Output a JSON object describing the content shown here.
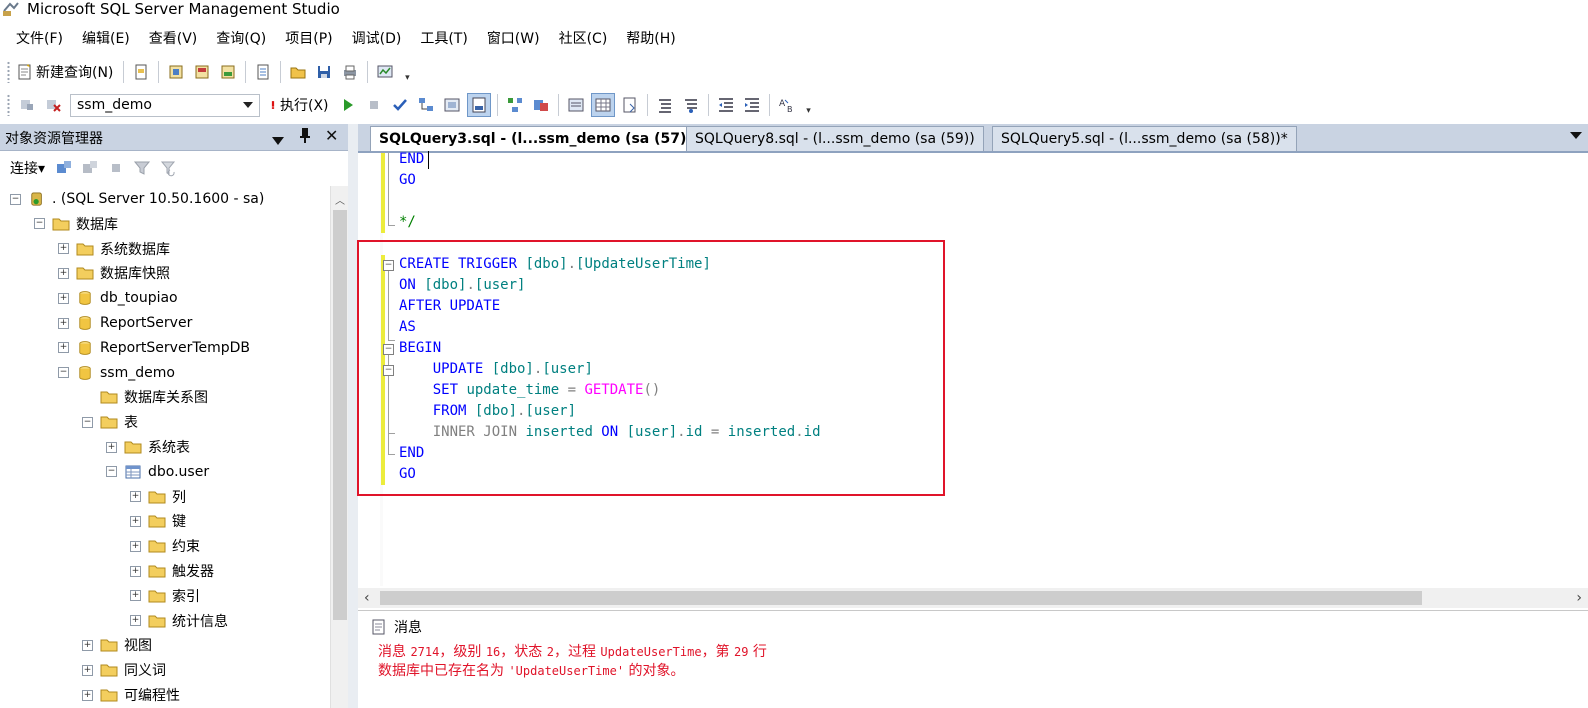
{
  "window": {
    "title": "Microsoft SQL Server Management Studio"
  },
  "menu": [
    "文件(F)",
    "编辑(E)",
    "查看(V)",
    "查询(Q)",
    "项目(P)",
    "调试(D)",
    "工具(T)",
    "窗口(W)",
    "社区(C)",
    "帮助(H)"
  ],
  "toolbar1": {
    "new_query_label": "新建查询(N)"
  },
  "toolbar2": {
    "database": "ssm_demo",
    "execute_label": "执行(X)"
  },
  "object_explorer": {
    "title": "对象资源管理器",
    "pin": "Ԅ",
    "close": "✕",
    "connect_label": "连接▾",
    "tree": [
      {
        "label": ". (SQL Server 10.50.1600 - sa)",
        "expander": "−",
        "icon": "server-icon",
        "depth": 0
      },
      {
        "label": "数据库",
        "expander": "−",
        "icon": "folder-icon",
        "depth": 1
      },
      {
        "label": "系统数据库",
        "expander": "+",
        "icon": "folder-icon",
        "depth": 2
      },
      {
        "label": "数据库快照",
        "expander": "+",
        "icon": "folder-icon",
        "depth": 2
      },
      {
        "label": "db_toupiao",
        "expander": "+",
        "icon": "database-icon",
        "depth": 2
      },
      {
        "label": "ReportServer",
        "expander": "+",
        "icon": "database-icon",
        "depth": 2
      },
      {
        "label": "ReportServerTempDB",
        "expander": "+",
        "icon": "database-icon",
        "depth": 2
      },
      {
        "label": "ssm_demo",
        "expander": "−",
        "icon": "database-icon",
        "depth": 2
      },
      {
        "label": "数据库关系图",
        "expander": "",
        "icon": "folder-icon",
        "depth": 3
      },
      {
        "label": "表",
        "expander": "−",
        "icon": "folder-icon",
        "depth": 3
      },
      {
        "label": "系统表",
        "expander": "+",
        "icon": "folder-icon",
        "depth": 4
      },
      {
        "label": "dbo.user",
        "expander": "−",
        "icon": "table-icon",
        "depth": 4
      },
      {
        "label": "列",
        "expander": "+",
        "icon": "folder-icon",
        "depth": 5
      },
      {
        "label": "键",
        "expander": "+",
        "icon": "folder-icon",
        "depth": 5
      },
      {
        "label": "约束",
        "expander": "+",
        "icon": "folder-icon",
        "depth": 5
      },
      {
        "label": "触发器",
        "expander": "+",
        "icon": "folder-icon",
        "depth": 5
      },
      {
        "label": "索引",
        "expander": "+",
        "icon": "folder-icon",
        "depth": 5
      },
      {
        "label": "统计信息",
        "expander": "+",
        "icon": "folder-icon",
        "depth": 5
      },
      {
        "label": "视图",
        "expander": "+",
        "icon": "folder-icon",
        "depth": 3
      },
      {
        "label": "同义词",
        "expander": "+",
        "icon": "folder-icon",
        "depth": 3
      },
      {
        "label": "可编程性",
        "expander": "+",
        "icon": "folder-icon",
        "depth": 3
      }
    ]
  },
  "tabs": [
    {
      "label": "SQLQuery3.sql - (l...ssm_demo (sa (57))*",
      "active": true
    },
    {
      "label": "SQLQuery8.sql - (l...ssm_demo (sa (59))",
      "active": false
    },
    {
      "label": "SQLQuery5.sql - (l...ssm_demo (sa (58))*",
      "active": false
    }
  ],
  "editor": {
    "lines": [
      [
        [
          "kw",
          "END"
        ]
      ],
      [
        [
          "kw",
          "GO"
        ]
      ],
      [],
      [
        [
          "cm",
          "*/"
        ]
      ],
      [],
      [
        [
          "kw",
          "CREATE TRIGGER "
        ],
        [
          "id",
          "[dbo]"
        ],
        [
          "op",
          "."
        ],
        [
          "id",
          "[UpdateUserTime]"
        ]
      ],
      [
        [
          "kw",
          "ON "
        ],
        [
          "id",
          "[dbo]"
        ],
        [
          "op",
          "."
        ],
        [
          "id",
          "[user]"
        ]
      ],
      [
        [
          "kw",
          "AFTER UPDATE"
        ]
      ],
      [
        [
          "kw",
          "AS"
        ]
      ],
      [
        [
          "kw",
          "BEGIN"
        ]
      ],
      [
        [
          "kw",
          "    UPDATE "
        ],
        [
          "id",
          "[dbo]"
        ],
        [
          "op",
          "."
        ],
        [
          "id",
          "[user]"
        ]
      ],
      [
        [
          "kw",
          "    SET "
        ],
        [
          "id",
          "update_time "
        ],
        [
          "op",
          "= "
        ],
        [
          "fn",
          "GETDATE"
        ],
        [
          "op",
          "()"
        ]
      ],
      [
        [
          "kw",
          "    FROM "
        ],
        [
          "id",
          "[dbo]"
        ],
        [
          "op",
          "."
        ],
        [
          "id",
          "[user]"
        ]
      ],
      [
        [
          "gy",
          "    INNER JOIN "
        ],
        [
          "id",
          "inserted "
        ],
        [
          "kw",
          "ON "
        ],
        [
          "id",
          "[user]"
        ],
        [
          "op",
          "."
        ],
        [
          "id",
          "id "
        ],
        [
          "op",
          "= "
        ],
        [
          "id",
          "inserted"
        ],
        [
          "op",
          "."
        ],
        [
          "id",
          "id"
        ]
      ],
      [
        [
          "kw",
          "END"
        ]
      ],
      [
        [
          "kw",
          "GO"
        ]
      ]
    ]
  },
  "messages": {
    "tab_label": "消息",
    "line1_prefix": "消息 ",
    "line1_code": "2714",
    "line1_mid1": "，级别 ",
    "line1_level": "16",
    "line1_mid2": "，状态 ",
    "line1_state": "2",
    "line1_mid3": "，过程 ",
    "line1_proc": "UpdateUserTime",
    "line1_mid4": "，第 ",
    "line1_line": "29",
    "line1_suffix": " 行",
    "line2_prefix": "数据库中已存在名为 ",
    "line2_name": "'UpdateUserTime'",
    "line2_suffix": " 的对象。"
  }
}
